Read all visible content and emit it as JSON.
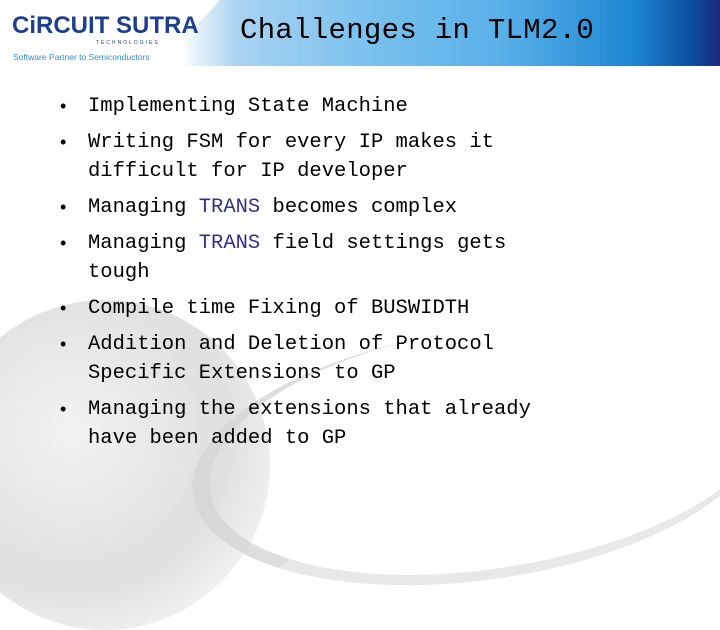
{
  "header": {
    "logo": {
      "brand_part1": "CiRCUIT",
      "brand_part2": "SUTRA",
      "subtitle": "TECHNOLOGIES",
      "tagline": "Software Partner to Semiconductors"
    },
    "title": "Challenges in TLM2.0"
  },
  "colors": {
    "highlight": "#2e3192",
    "header_dark": "#1c2a7a",
    "header_light": "#7cc2ee"
  },
  "bullets": [
    {
      "segments": [
        {
          "text": "Implementing State Machine"
        }
      ]
    },
    {
      "segments": [
        {
          "text": "Writing FSM for every IP makes it\ndifficult for IP developer"
        }
      ]
    },
    {
      "segments": [
        {
          "text": "Managing "
        },
        {
          "text": "TRANS",
          "highlight": true
        },
        {
          "text": " becomes complex"
        }
      ]
    },
    {
      "segments": [
        {
          "text": "Managing "
        },
        {
          "text": "TRANS",
          "highlight": true
        },
        {
          "text": " field settings gets\ntough"
        }
      ]
    },
    {
      "segments": [
        {
          "text": "Compile time Fixing of BUSWIDTH"
        }
      ]
    },
    {
      "segments": [
        {
          "text": "Addition and Deletion of Protocol\nSpecific Extensions to GP"
        }
      ]
    },
    {
      "segments": [
        {
          "text": "Managing the extensions that already\nhave been added to GP"
        }
      ]
    }
  ],
  "bullet_glyph": "•"
}
